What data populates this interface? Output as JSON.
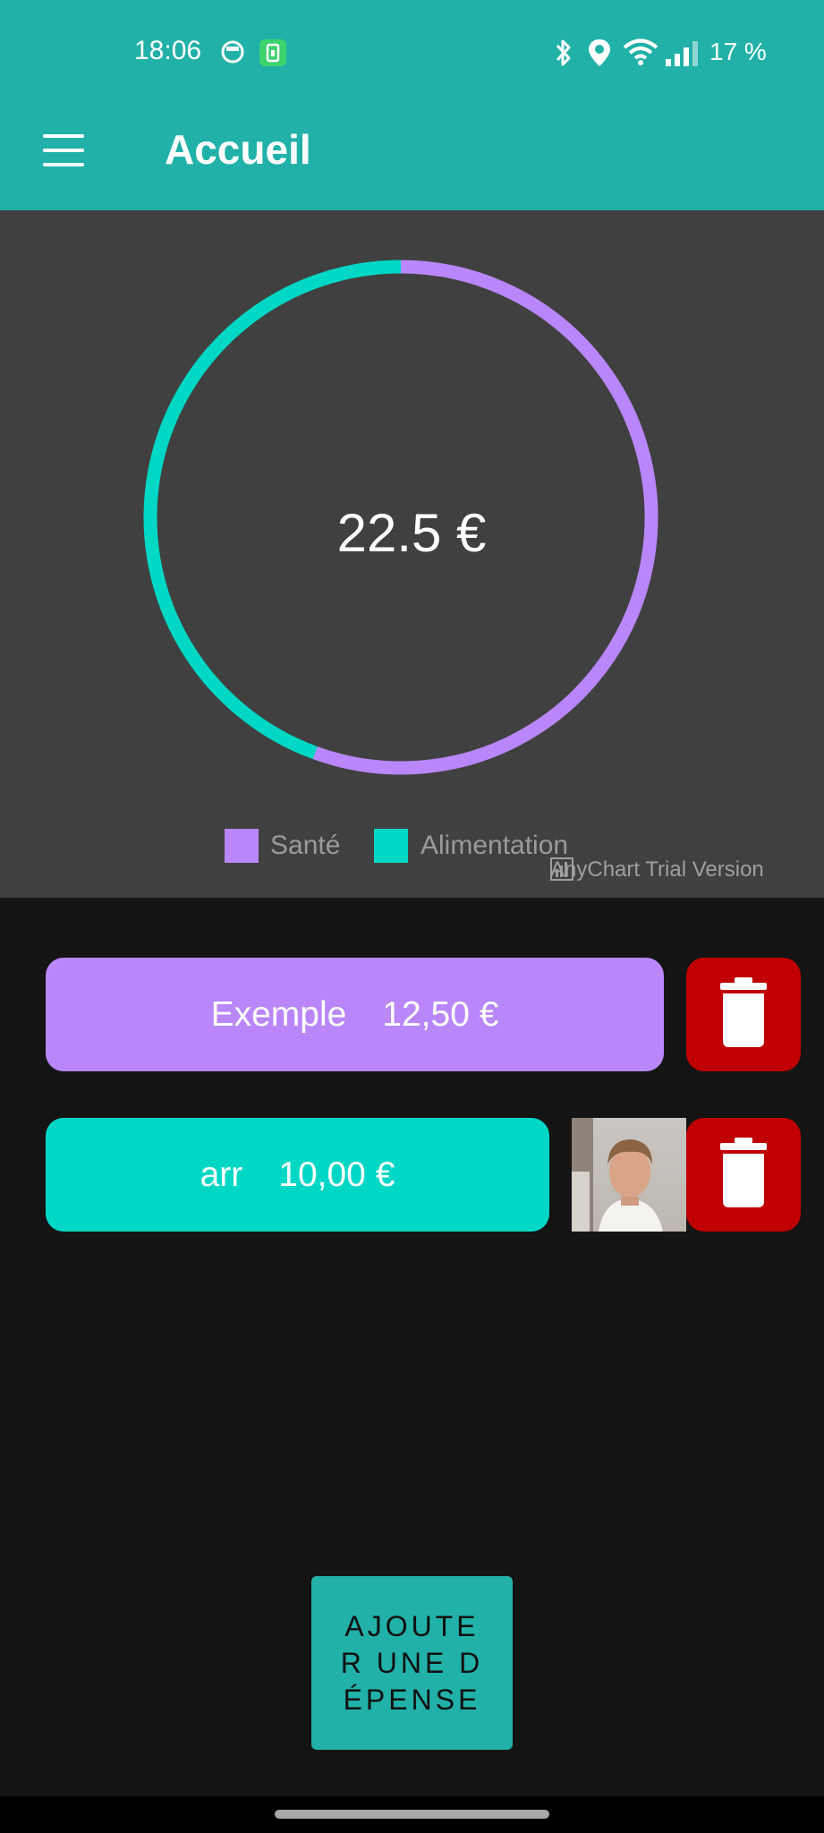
{
  "status_bar": {
    "time": "18:06",
    "battery_percent": "17 %",
    "icons": [
      "face-notification-icon",
      "battery-saver-icon",
      "bluetooth-icon",
      "location-icon",
      "wifi-icon",
      "signal-icon"
    ]
  },
  "app_bar": {
    "title": "Accueil",
    "menu_icon": "hamburger-menu-icon"
  },
  "chart": {
    "total_label": "22.5 €",
    "trial_label": "AnyChart Trial Version"
  },
  "chart_data": {
    "type": "pie",
    "style": "donut-ring",
    "categories": [
      "Santé",
      "Alimentation"
    ],
    "values": [
      12.5,
      10
    ],
    "colors": [
      "#b987fa",
      "#00d8c5"
    ],
    "center_label": "22.5 €",
    "legend_position": "bottom"
  },
  "expenses": [
    {
      "name": "Exemple",
      "amount": "12,50 €",
      "color": "#b987fa",
      "has_photo": false
    },
    {
      "name": "arr",
      "amount": "10,00 €",
      "color": "#00d8c5",
      "has_photo": true
    }
  ],
  "add_button": {
    "label": "AJOUTER UNE DÉPENSE"
  },
  "colors": {
    "primary": "#21b1a8",
    "chart_background": "#404040",
    "page_background": "#141414",
    "delete": "#c00000"
  }
}
